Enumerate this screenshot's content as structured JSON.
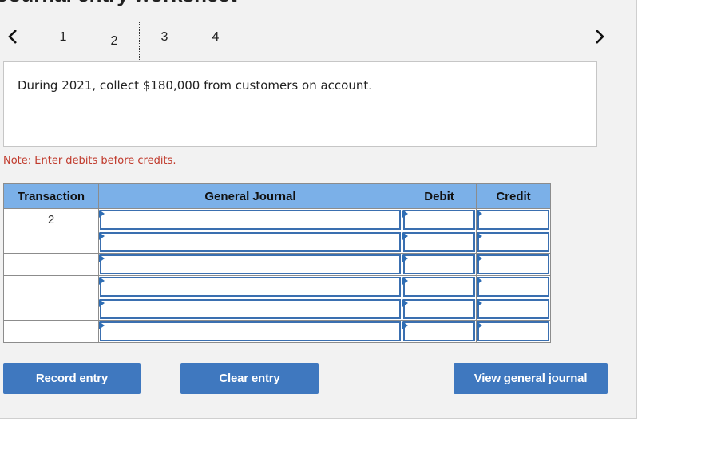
{
  "header": {
    "title": "Journal entry worksheet"
  },
  "pagination": {
    "prev_icon": "chevron-left-icon",
    "next_icon": "chevron-right-icon",
    "pages": [
      "1",
      "2",
      "3",
      "4"
    ],
    "active_page": "2"
  },
  "transaction": {
    "description": "During 2021, collect $180,000 from customers on account."
  },
  "note": "Note: Enter debits before credits.",
  "journal": {
    "headers": {
      "transaction": "Transaction",
      "general_journal": "General Journal",
      "debit": "Debit",
      "credit": "Credit"
    },
    "rows": [
      {
        "transaction": "2",
        "account": "",
        "debit": "",
        "credit": ""
      },
      {
        "transaction": "",
        "account": "",
        "debit": "",
        "credit": ""
      },
      {
        "transaction": "",
        "account": "",
        "debit": "",
        "credit": ""
      },
      {
        "transaction": "",
        "account": "",
        "debit": "",
        "credit": ""
      },
      {
        "transaction": "",
        "account": "",
        "debit": "",
        "credit": ""
      },
      {
        "transaction": "",
        "account": "",
        "debit": "",
        "credit": ""
      }
    ]
  },
  "buttons": {
    "record": "Record entry",
    "clear": "Clear entry",
    "view": "View general journal"
  },
  "colors": {
    "header_bg": "#7bb0e8",
    "button_bg": "#3f78bf",
    "note_text": "#c0392b",
    "input_border": "#3a6fb0"
  }
}
